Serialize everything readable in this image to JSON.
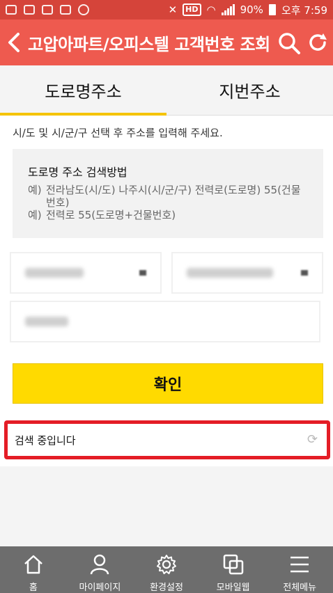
{
  "status_bar": {
    "hd": "HD",
    "battery": "90%",
    "time": "오후 7:59"
  },
  "header": {
    "title": "고압아파트/오피스텔 고객번호 조회"
  },
  "tabs": [
    {
      "label": "도로명주소"
    },
    {
      "label": "지번주소"
    }
  ],
  "content": {
    "hint": "시/도 및 시/군/구 선택 후 주소를 입력해 주세요.",
    "guide": {
      "title": "도로명 주소 검색방법",
      "lines": [
        {
          "prefix": "예)",
          "text": "전라남도(시/도) 나주시(시/군/구) 전력로(도로명) 55(건물번호)"
        },
        {
          "prefix": "예)",
          "text": "전력로 55(도로명+건물번호)"
        }
      ]
    },
    "confirm_label": "확인",
    "status_text": "검색 중입니다"
  },
  "bottom_nav": [
    {
      "label": "홈",
      "icon": "home-icon"
    },
    {
      "label": "마이페이지",
      "icon": "person-icon"
    },
    {
      "label": "환경설정",
      "icon": "gear-icon"
    },
    {
      "label": "모바일웹",
      "icon": "mobile-web-icon"
    },
    {
      "label": "전체메뉴",
      "icon": "menu-icon"
    }
  ]
}
